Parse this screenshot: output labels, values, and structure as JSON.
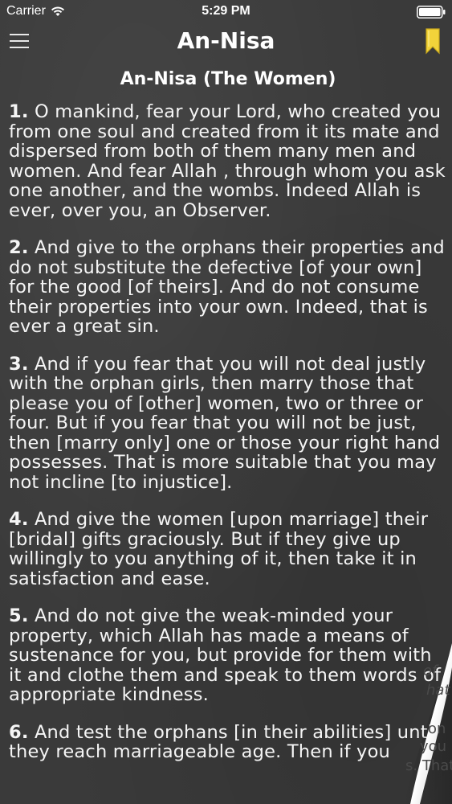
{
  "status_bar": {
    "carrier": "Carrier",
    "time": "5:29 PM"
  },
  "nav": {
    "title": "An-Nisa",
    "menu_icon": "hamburger-menu-icon",
    "bookmark_icon": "bookmark-icon",
    "bookmark_color": "#f2d33a"
  },
  "surah": {
    "heading": "An-Nisa (The Women)"
  },
  "verses": [
    {
      "num": "1.",
      "text": "O mankind, fear your Lord, who created you from one soul and created from it its mate and dispersed from both of them many men and women. And fear Allah , through whom you ask one another, and the wombs. Indeed Allah is ever, over you, an Observer."
    },
    {
      "num": "2.",
      "text": "And give to the orphans their properties and do not substitute the defective [of your own] for the good [of theirs]. And do not consume their properties into your own. Indeed, that is ever a great sin."
    },
    {
      "num": "3.",
      "text": "And if you fear that you will not deal justly with the orphan girls, then marry those that please you of [other] women, two or three or four. But if you fear that you will not be just, then [marry only] one or those your right hand possesses. That is more suitable that you may not incline [to injustice]."
    },
    {
      "num": "4.",
      "text": "And give the women [upon marriage] their [bridal] gifts graciously. But if they give up willingly to you anything of it, then take it in satisfaction and ease."
    },
    {
      "num": "5.",
      "text": "And do not give the weak-minded your property, which Allah has made a means of sustenance for you, but provide for them with it and clothe them and speak to them words of appropriate kindness."
    },
    {
      "num": "6.",
      "text": "And test the orphans [in their abilities] until they reach marriageable age. Then if you"
    }
  ],
  "page_curl": {
    "fragments": [
      "of",
      "hat",
      "on",
      "you",
      "s. That"
    ]
  }
}
